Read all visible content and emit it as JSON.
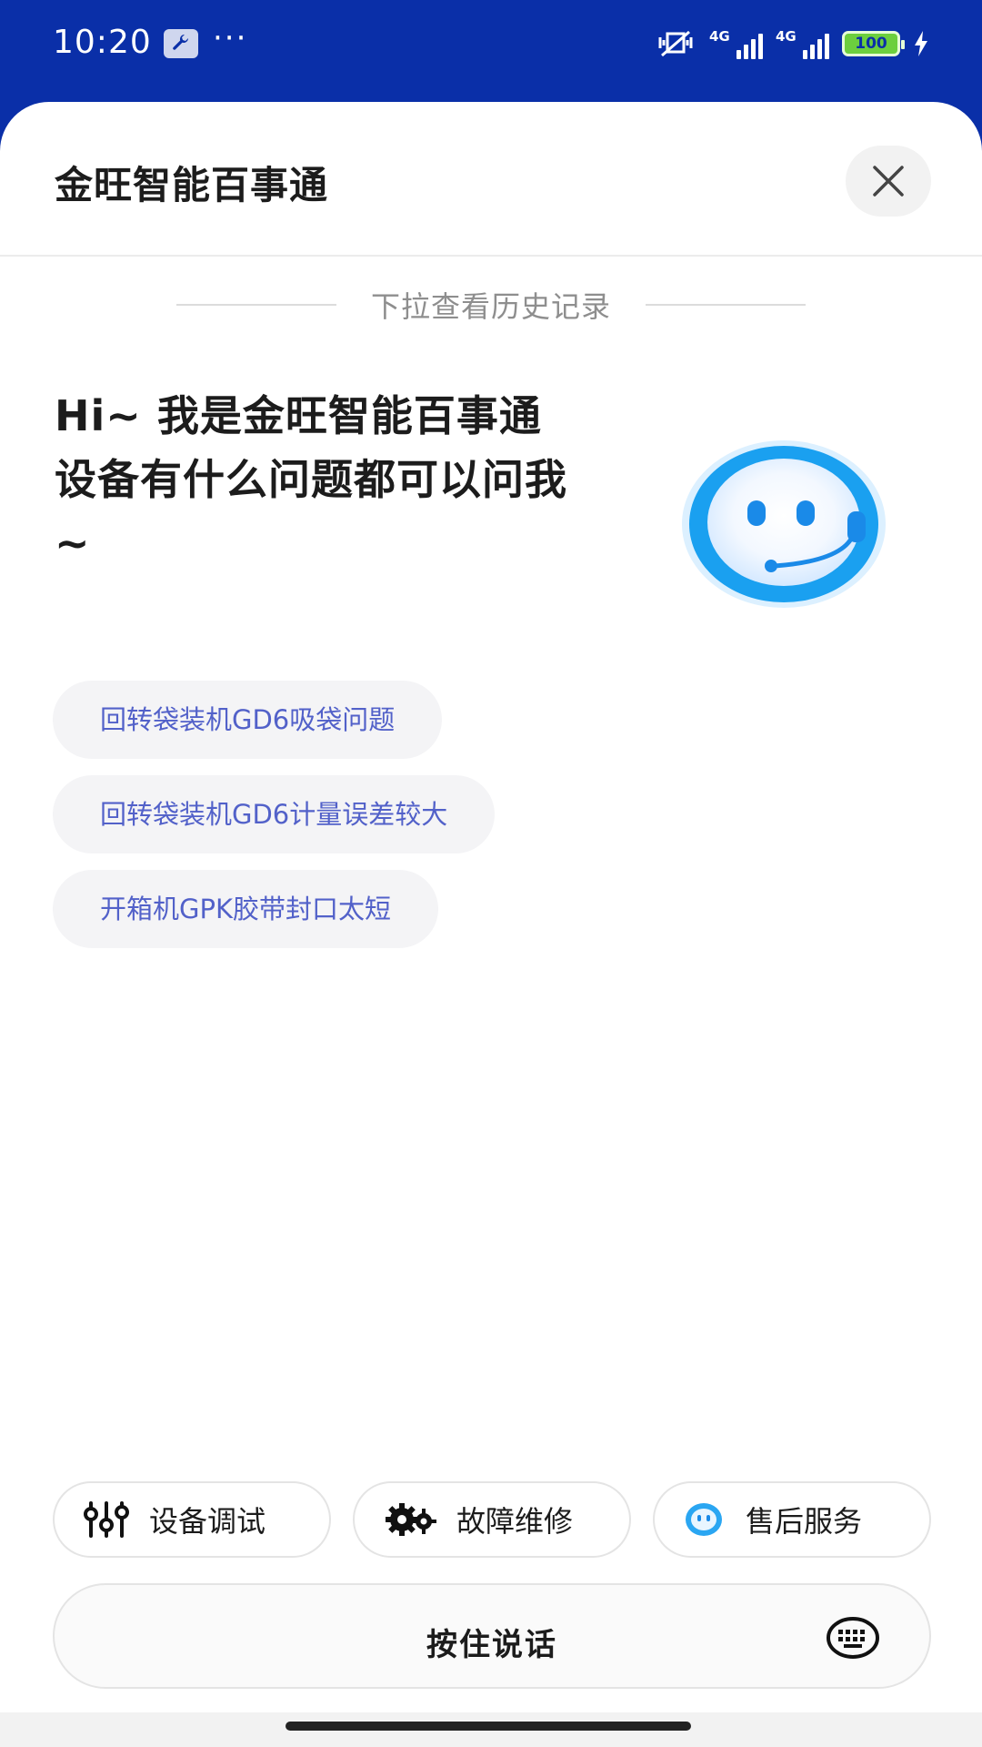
{
  "status_bar": {
    "time": "10:20",
    "dots": "···",
    "network_1": "4G",
    "network_2": "4G",
    "battery": "100"
  },
  "header": {
    "title": "金旺智能百事通"
  },
  "history_hint": "下拉查看历史记录",
  "greeting": {
    "line1": "Hi~ 我是金旺智能百事通",
    "line2": "设备有什么问题都可以问我~"
  },
  "suggestions": [
    "回转袋装机GD6吸袋问题",
    "回转袋装机GD6计量误差较大",
    "开箱机GPK胶带封口太短"
  ],
  "quick_actions": [
    {
      "label": "设备调试",
      "icon": "sliders-icon"
    },
    {
      "label": "故障维修",
      "icon": "gears-icon"
    },
    {
      "label": "售后服务",
      "icon": "service-face-icon"
    }
  ],
  "input": {
    "talk_label": "按住说话"
  },
  "colors": {
    "status_bar_bg": "#0a2fa8",
    "chip_text": "#5261c9",
    "avatar_blue": "#1aa0f0"
  }
}
